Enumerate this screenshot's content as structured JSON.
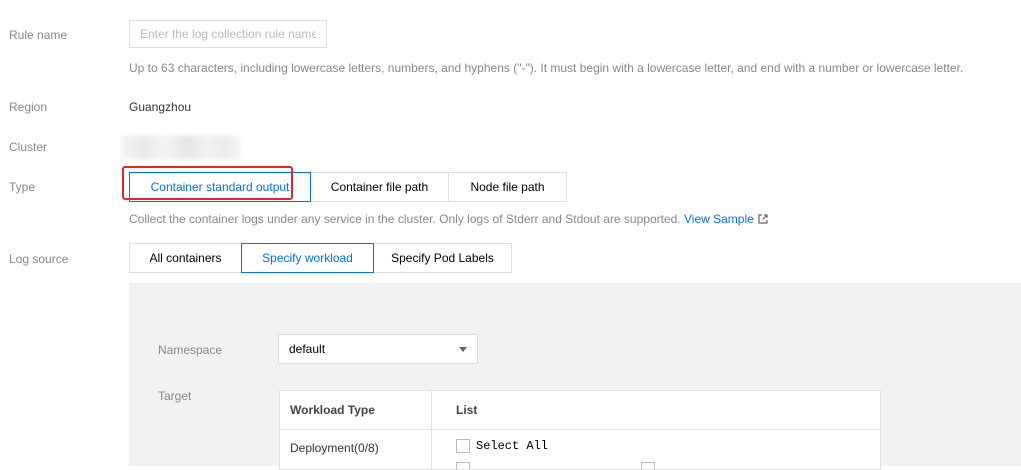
{
  "form": {
    "rule_name": {
      "label": "Rule name",
      "placeholder": "Enter the log collection rule name",
      "hint": "Up to 63 characters, including lowercase letters, numbers, and hyphens (\"-\"). It must begin with a lowercase letter, and end with a number or lowercase letter."
    },
    "region": {
      "label": "Region",
      "value": "Guangzhou"
    },
    "cluster": {
      "label": "Cluster"
    },
    "type": {
      "label": "Type",
      "options": [
        "Container standard output",
        "Container file path",
        "Node file path"
      ],
      "selected": "Container standard output",
      "hint": "Collect the container logs under any service in the cluster. Only logs of Stderr and Stdout are supported.",
      "link": "View Sample"
    },
    "log_source": {
      "label": "Log source",
      "options": [
        "All containers",
        "Specify workload",
        "Specify Pod Labels"
      ],
      "selected": "Specify workload",
      "namespace": {
        "label": "Namespace",
        "value": "default"
      },
      "target": {
        "label": "Target",
        "columns": [
          "Workload Type",
          "List"
        ],
        "rows": [
          {
            "type": "Deployment(0/8)",
            "select_all": "Select All"
          }
        ]
      }
    }
  },
  "colors": {
    "accent": "#006eff",
    "highlight": "#e5242b",
    "panel": "#f2f2f2"
  }
}
